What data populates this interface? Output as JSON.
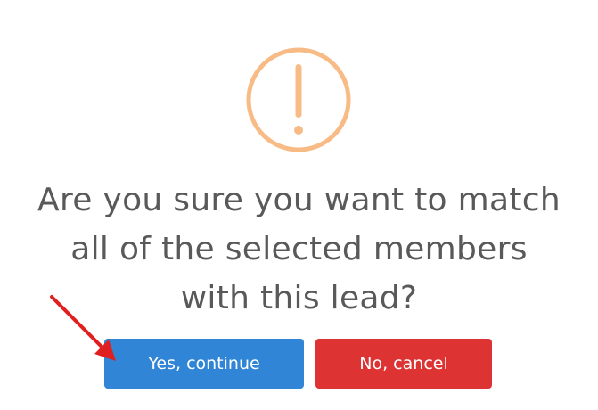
{
  "dialog": {
    "icon": "warning-exclamation-icon",
    "icon_color": "#f8bb86",
    "title": "Are you sure you want to match\nall of the selected members\nwith this lead?",
    "confirm_label": "Yes, continue",
    "confirm_color": "#3085d6",
    "cancel_label": "No, cancel",
    "cancel_color": "#dd3333"
  },
  "annotation": {
    "icon": "red-arrow-pointer-icon",
    "color": "#e02020"
  }
}
